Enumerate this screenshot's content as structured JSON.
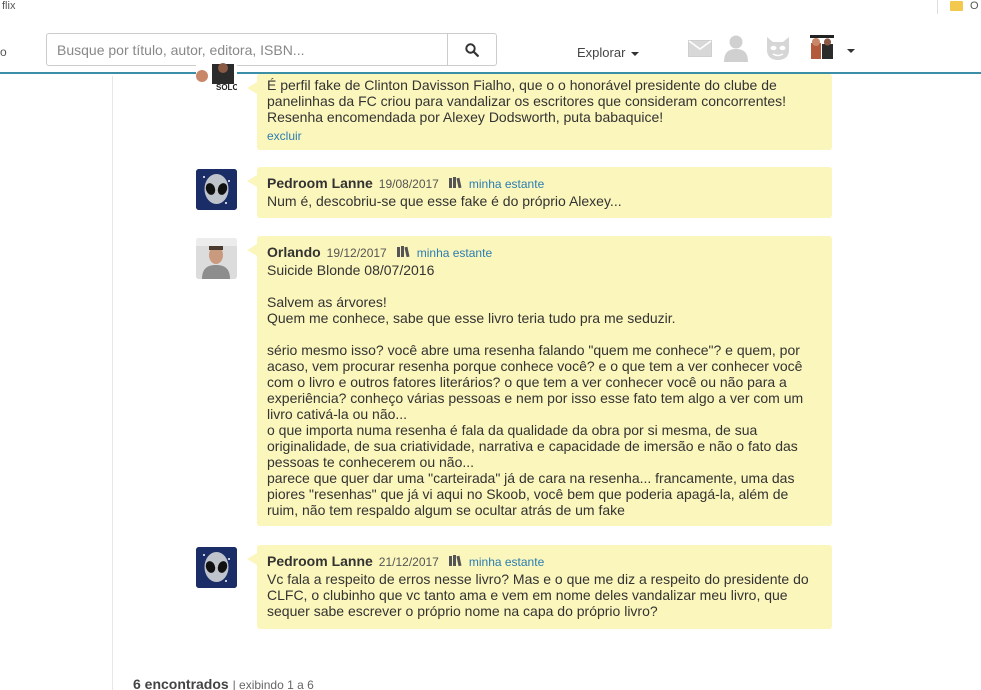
{
  "browser": {
    "bookmark_left": "flix",
    "bookmark_right": "O"
  },
  "header": {
    "left_edge": "o",
    "search_placeholder": "Busque por título, autor, editora, ISBN...",
    "explore_label": "Explorar",
    "icons": [
      "envelope-icon",
      "user-silhouette-icon",
      "cat-mask-icon",
      "user-avatar-icon"
    ]
  },
  "comments": [
    {
      "author": "",
      "date": "",
      "shelf_label": "",
      "body": "É perfil fake de Clinton Davisson Fialho, que o o honorável presidente do clube de panelinhas da FC criou para vandalizar os escritores que consideram concorrentes! Resenha encomendada por Alexey Dodsworth, puta babaquice!",
      "delete_label": "excluir",
      "avatar_text": "SOLO"
    },
    {
      "author": "Pedroom Lanne",
      "date": "19/08/2017",
      "shelf_label": "minha estante",
      "body": "Num é, descobriu-se que esse fake é do próprio Alexey..."
    },
    {
      "author": "Orlando",
      "date": "19/12/2017",
      "shelf_label": "minha estante",
      "body": "Suicide Blonde 08/07/2016\n\nSalvem as árvores!\nQuem me conhece, sabe que esse livro teria tudo pra me seduzir.\n\nsério mesmo isso? você abre uma resenha falando \"quem me conhece\"? e quem, por acaso, vem procurar resenha porque conhece você? e o que tem a ver conhecer você com o livro e outros fatores literários? o que tem a ver conhecer você ou não para a experiência? conheço várias pessoas e nem por isso esse fato tem algo a ver com um livro cativá-la ou não...\no que importa numa resenha é fala da qualidade da obra por si mesma, de sua originalidade, de sua criatividade, narrativa e capacidade de imersão e não o fato das pessoas te conhecerem ou não...\nparece que quer dar uma \"carteirada\" já de cara na resenha... francamente, uma das piores \"resenhas\" que já vi aqui no Skoob, você bem que poderia apagá-la, além de ruim, não tem respaldo algum se ocultar atrás de um fake"
    },
    {
      "author": "Pedroom Lanne",
      "date": "21/12/2017",
      "shelf_label": "minha estante",
      "body": "Vc fala a respeito de erros nesse livro? Mas e o que me diz a respeito do presidente do CLFC, o clubinho que vc tanto ama e vem em nome deles vandalizar meu livro, que sequer sabe escrever o próprio nome na capa do próprio livro?"
    }
  ],
  "footer": {
    "count_label": "6 encontrados",
    "range_label": "| exibindo 1 a 6"
  },
  "colors": {
    "bubble": "#fbf6bb",
    "link": "#2a7db4",
    "header_border": "#3a8fa6"
  }
}
